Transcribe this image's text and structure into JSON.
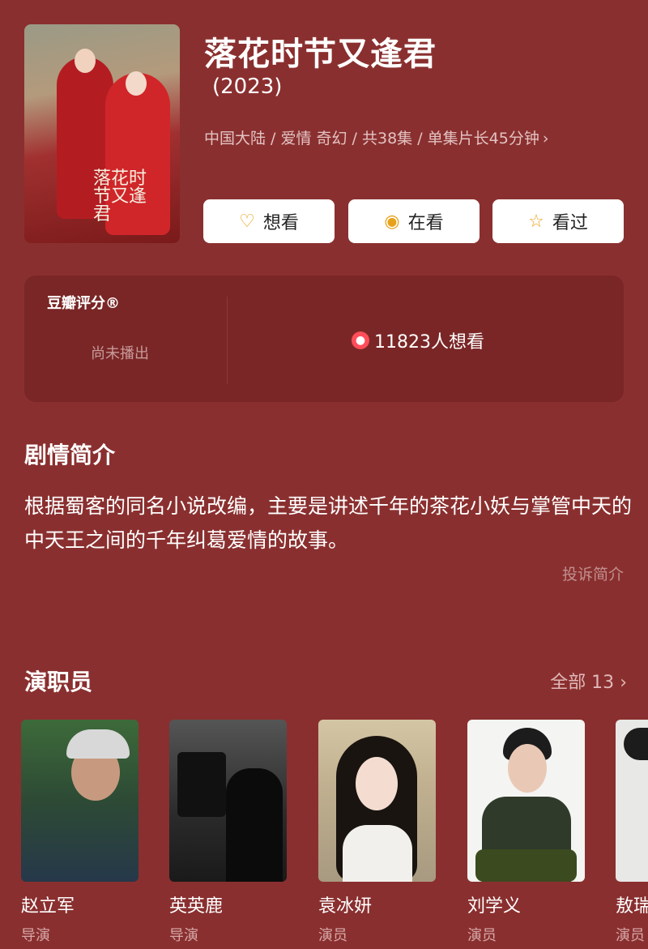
{
  "show": {
    "title": "落花时节又逢君",
    "year": "(2023)",
    "meta": "中国大陆 / 爱情 奇幻 / 共38集 / 单集片长45分钟",
    "poster_text": "落花时节又逢君"
  },
  "actions": {
    "want": {
      "label": "想看",
      "icon": "heart-plus-icon"
    },
    "watching": {
      "label": "在看",
      "icon": "target-icon"
    },
    "watched": {
      "label": "看过",
      "icon": "star-icon"
    },
    "accent": "#e7a21b"
  },
  "rating": {
    "label": "豆瓣评分®",
    "state": "尚未播出",
    "wish_count": "11823人想看"
  },
  "synopsis": {
    "title": "剧情简介",
    "text": "根据蜀客的同名小说改编，主要是讲述千年的茶花小妖与掌管中天的中天王之间的千年纠葛爱情的故事。",
    "report": "投诉简介"
  },
  "cast": {
    "title": "演职员",
    "all_label": "全部 13",
    "items": [
      {
        "name": "赵立军",
        "role": "导演"
      },
      {
        "name": "英英鹿",
        "role": "导演"
      },
      {
        "name": "袁冰妍",
        "role": "演员"
      },
      {
        "name": "刘学义",
        "role": "演员"
      },
      {
        "name": "敖瑞",
        "role": "演员"
      }
    ]
  },
  "colors": {
    "background": "#8a2f2f",
    "card": "#7a2626",
    "button": "#ffffff"
  }
}
